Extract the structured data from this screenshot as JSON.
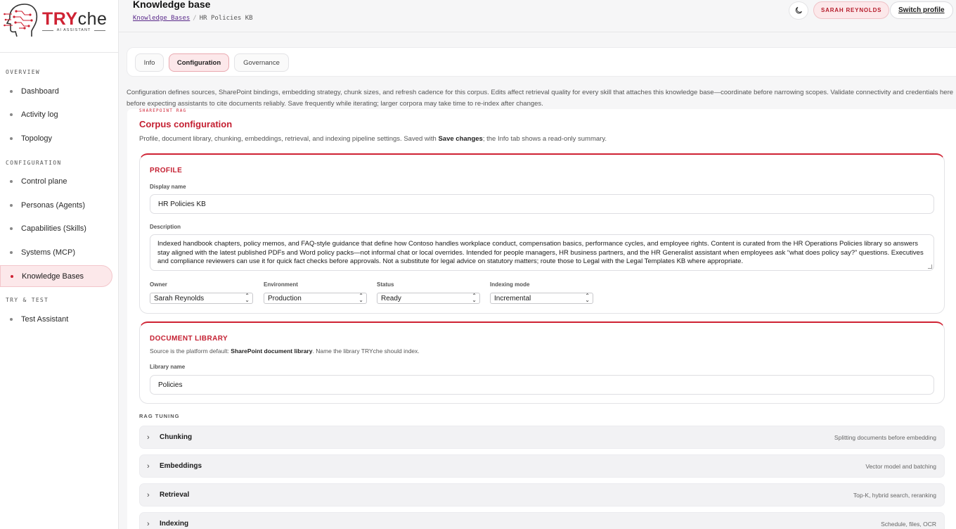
{
  "brand": {
    "name_tr": "TRY",
    "name_che": "che",
    "tagline": "AI ASSISTANT"
  },
  "sidebar": {
    "sections": [
      {
        "label": "OVERVIEW",
        "items": [
          "Dashboard",
          "Activity log",
          "Topology"
        ]
      },
      {
        "label": "CONFIGURATION",
        "items": [
          "Control plane",
          "Personas (Agents)",
          "Capabilities (Skills)",
          "Systems (MCP)",
          "Knowledge Bases"
        ]
      },
      {
        "label": "TRY & TEST",
        "items": [
          "Test Assistant"
        ]
      }
    ],
    "active": "Knowledge Bases"
  },
  "header": {
    "title": "Knowledge base",
    "breadcrumb_link": "Knowledge Bases",
    "breadcrumb_sep": "/",
    "breadcrumb_current": "HR Policies KB",
    "theme_icon": "moon-icon",
    "user_badge": "SARAH REYNOLDS",
    "switch_label": "Switch profile"
  },
  "tabs": [
    "Info",
    "Configuration",
    "Governance"
  ],
  "active_tab": "Configuration",
  "intro": "Configuration defines sources, SharePoint bindings, embedding strategy, chunk sizes, and refresh cadence for this corpus. Edits affect retrieval quality for every skill that attaches this knowledge base—coordinate before narrowing scopes. Validate connectivity and credentials here before expecting assistants to cite documents reliably. Save frequently while iterating; larger corpora may take time to re-index after changes.",
  "corpus": {
    "eyebrow": "SHAREPOINT RAG",
    "title": "Corpus configuration",
    "desc_pre": "Profile, document library, chunking, embeddings, retrieval, and indexing pipeline settings. Saved with ",
    "desc_bold": "Save changes",
    "desc_post": "; the Info tab shows a read-only summary."
  },
  "profile": {
    "title": "PROFILE",
    "display_name_label": "Display name",
    "display_name": "HR Policies KB",
    "description_label": "Description",
    "description": "Indexed handbook chapters, policy memos, and FAQ-style guidance that define how Contoso handles workplace conduct, compensation basics, performance cycles, and employee rights. Content is curated from the HR Operations Policies library so answers stay aligned with the latest published PDFs and Word policy packs—not informal chat or local overrides. Intended for people managers, HR business partners, and the HR Generalist assistant when employees ask “what does policy say?” questions. Executives and compliance reviewers can use it for quick fact checks before approvals. Not a substitute for legal advice on statutory matters; route those to Legal with the Legal Templates KB where appropriate.",
    "owner_label": "Owner",
    "owner": "Sarah Reynolds",
    "environment_label": "Environment",
    "environment": "Production",
    "status_label": "Status",
    "status": "Ready",
    "indexing_label": "Indexing mode",
    "indexing": "Incremental"
  },
  "library": {
    "title": "DOCUMENT LIBRARY",
    "sub_pre": "Source is the platform default: ",
    "sub_bold": "SharePoint document library",
    "sub_post": ". Name the library TRYche should index.",
    "name_label": "Library name",
    "name": "Policies"
  },
  "rag": {
    "label": "RAG TUNING",
    "sections": [
      {
        "title": "Chunking",
        "hint": "Splitting documents before embedding"
      },
      {
        "title": "Embeddings",
        "hint": "Vector model and batching"
      },
      {
        "title": "Retrieval",
        "hint": "Top-K, hybrid search, reranking"
      },
      {
        "title": "Indexing",
        "hint": "Schedule, files, OCR"
      }
    ]
  },
  "colors": {
    "accent": "#cf2233",
    "accent_bg": "#fce8ea"
  }
}
